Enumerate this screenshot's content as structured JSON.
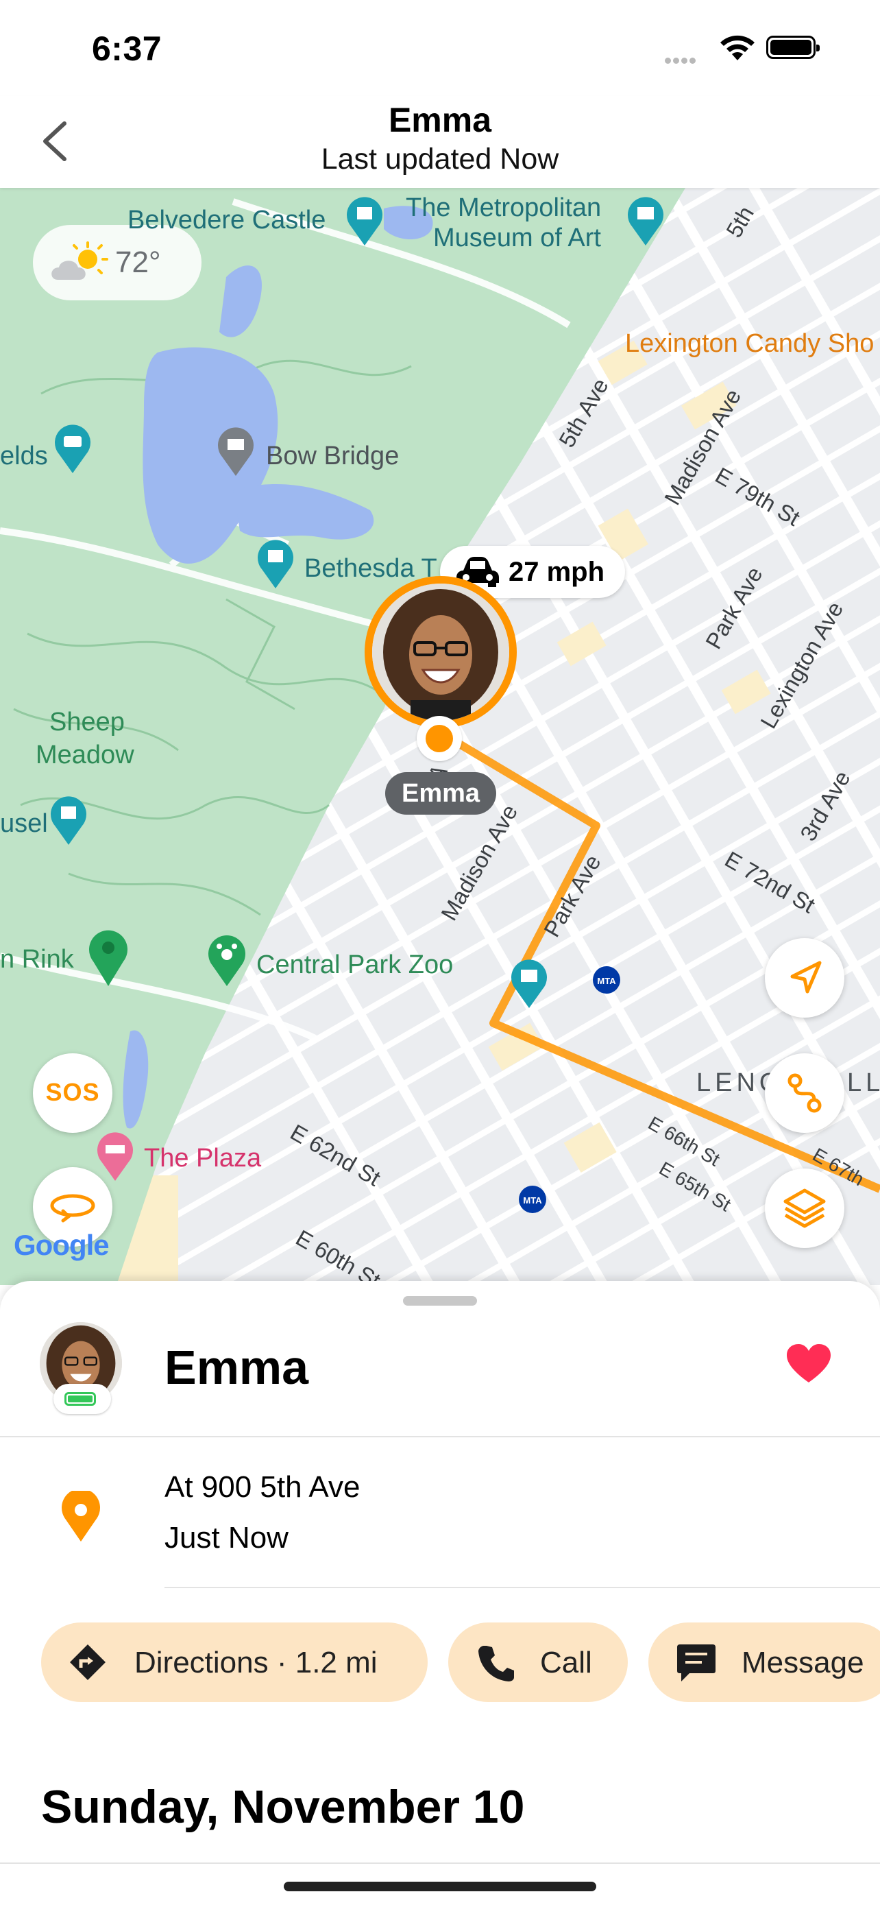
{
  "status_bar": {
    "time": "6:37"
  },
  "header": {
    "title": "Emma",
    "subtitle": "Last updated Now"
  },
  "map": {
    "weather_temp": "72°",
    "speed": "27 mph",
    "person_label": "Emma",
    "labels": {
      "belvedere": "Belvedere Castle",
      "met1": "The Metropolitan",
      "met2": "Museum of Art",
      "lexington_candy": "Lexington Candy Sho",
      "elds": "elds",
      "bow_bridge": "Bow Bridge",
      "bethesda": "Bethesda T",
      "sheep1": "Sheep",
      "sheep2": "Meadow",
      "usel": "usel",
      "rink": "n Rink",
      "zoo": "Central Park Zoo",
      "plaza": "The Plaza",
      "lenox": "LENO",
      "ll": "LL",
      "fifth_ave": "5th Ave",
      "fifth_top": "5th",
      "madison_top": "Madison Ave",
      "madison_mid": "Madison Ave",
      "park_ave_top": "Park Ave",
      "park_ave_mid": "Park Ave",
      "lexington_ave": "Lexington Ave",
      "third_ave": "3rd Ave",
      "e79": "E 79th St",
      "e72": "E 72nd St",
      "e66": "E 66th St",
      "e65": "E 65th St",
      "e67": "E 67th",
      "e62": "E 62nd St",
      "e60": "E 60th St",
      "fifth_mid": "5th A",
      "mta": "MTA",
      "google": "Google"
    },
    "sos_label": "SOS"
  },
  "sheet": {
    "person_name": "Emma",
    "address": "At 900 5th Ave",
    "time_ago": "Just Now",
    "actions": {
      "directions": "Directions · 1.2 mi",
      "call": "Call",
      "message": "Message"
    },
    "date_heading": "Sunday, November 10"
  },
  "colors": {
    "accent": "#ff9500",
    "park": "#bfe3c7",
    "water": "#9db8f0",
    "heart": "#ff2d55"
  }
}
